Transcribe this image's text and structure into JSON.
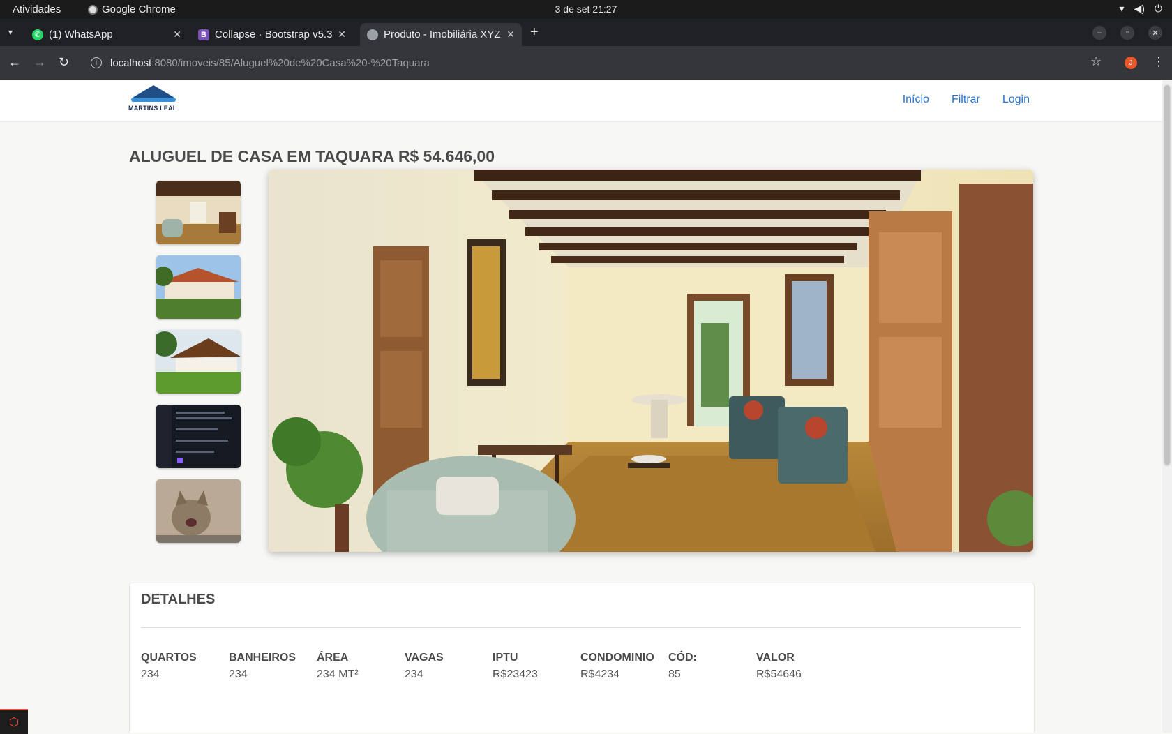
{
  "system": {
    "activities": "Atividades",
    "app_name": "Google Chrome",
    "clock": "3 de set  21:27"
  },
  "tabs": [
    {
      "title": "(1) WhatsApp",
      "favicon": "whatsapp-icon",
      "active": false
    },
    {
      "title": "Collapse · Bootstrap v5.3",
      "favicon": "bootstrap-icon",
      "active": false
    },
    {
      "title": "Produto - Imobiliária XYZ",
      "favicon": "globe-icon",
      "active": true
    }
  ],
  "address_bar": {
    "host": "localhost",
    "path": ":8080/imoveis/85/Aluguel%20de%20Casa%20-%20Taquara"
  },
  "profile_initial": "J",
  "site": {
    "logo_text": "MARTINS LEAL",
    "nav": [
      {
        "label": "Início"
      },
      {
        "label": "Filtrar"
      },
      {
        "label": "Login"
      }
    ]
  },
  "product": {
    "title": "ALUGUEL DE CASA EM TAQUARA R$ 54.646,00",
    "thumbnails": [
      "interior",
      "house-exterior",
      "chalet-exterior",
      "code-screenshot",
      "kitten"
    ]
  },
  "details": {
    "heading": "DETALHES",
    "items": [
      {
        "label": "QUARTOS",
        "value": "234"
      },
      {
        "label": "BANHEIROS",
        "value": "234"
      },
      {
        "label": "ÁREA",
        "value": "234 MT²"
      },
      {
        "label": "VAGAS",
        "value": "234"
      },
      {
        "label": "IPTU",
        "value": "R$23423"
      },
      {
        "label": "CONDOMINIO",
        "value": "R$4234"
      },
      {
        "label": "CÓD:",
        "value": "85"
      },
      {
        "label": "VALOR",
        "value": "R$54646"
      }
    ]
  },
  "colors": {
    "link": "#2474d6",
    "chrome_dark": "#35363a",
    "page_bg": "#f7f7f5"
  }
}
